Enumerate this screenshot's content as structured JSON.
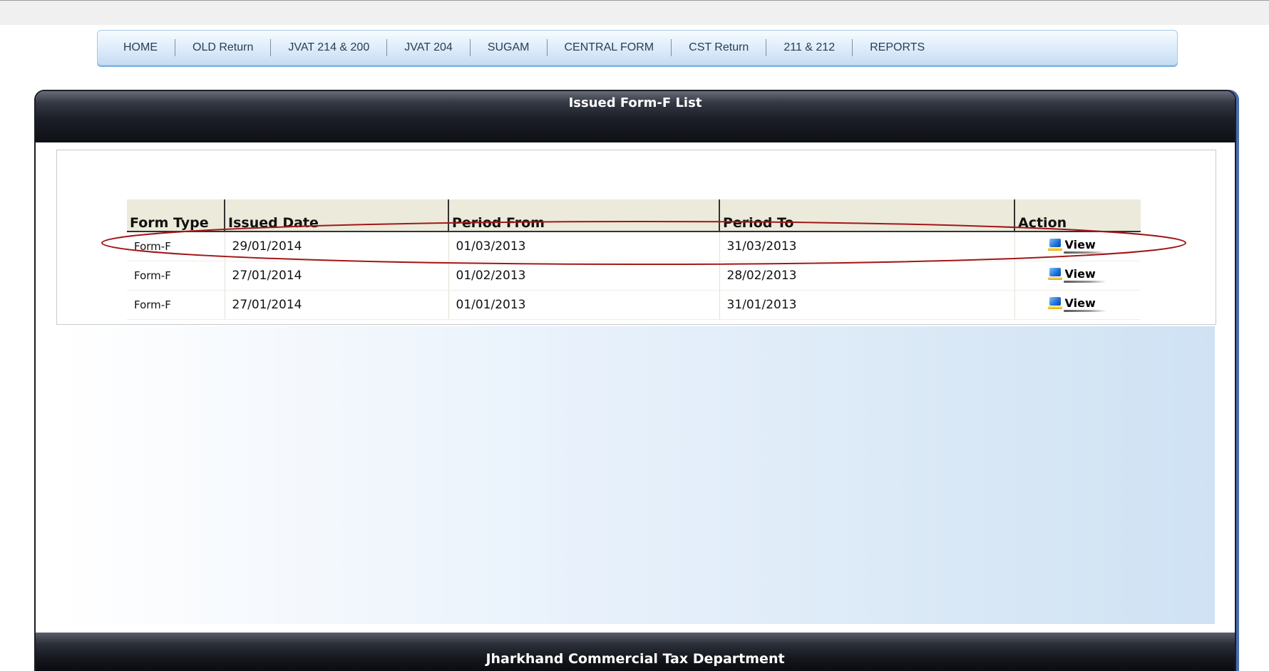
{
  "nav": {
    "items": [
      {
        "label": "HOME"
      },
      {
        "label": "OLD Return"
      },
      {
        "label": "JVAT 214 & 200"
      },
      {
        "label": "JVAT 204"
      },
      {
        "label": "SUGAM"
      },
      {
        "label": "CENTRAL FORM"
      },
      {
        "label": "CST Return"
      },
      {
        "label": "211 & 212"
      },
      {
        "label": "REPORTS"
      }
    ]
  },
  "panel": {
    "title": "Issued Form-F List",
    "footer": "Jharkhand Commercial Tax Department"
  },
  "table": {
    "headers": [
      "Form Type",
      "Issued Date",
      "Period From",
      "Period To",
      "Action"
    ],
    "rows": [
      {
        "form_type": "Form-F",
        "issued_date": "29/01/2014",
        "period_from": "01/03/2013",
        "period_to": "31/03/2013",
        "action": "View"
      },
      {
        "form_type": "Form-F",
        "issued_date": "27/01/2014",
        "period_from": "01/02/2013",
        "period_to": "28/02/2013",
        "action": "View"
      },
      {
        "form_type": "Form-F",
        "issued_date": "27/01/2014",
        "period_from": "01/01/2013",
        "period_to": "31/01/2013",
        "action": "View"
      }
    ]
  },
  "colors": {
    "highlight": "#a01818",
    "header_bar": "#1b1e26",
    "table_header_bg": "#eceadb"
  }
}
